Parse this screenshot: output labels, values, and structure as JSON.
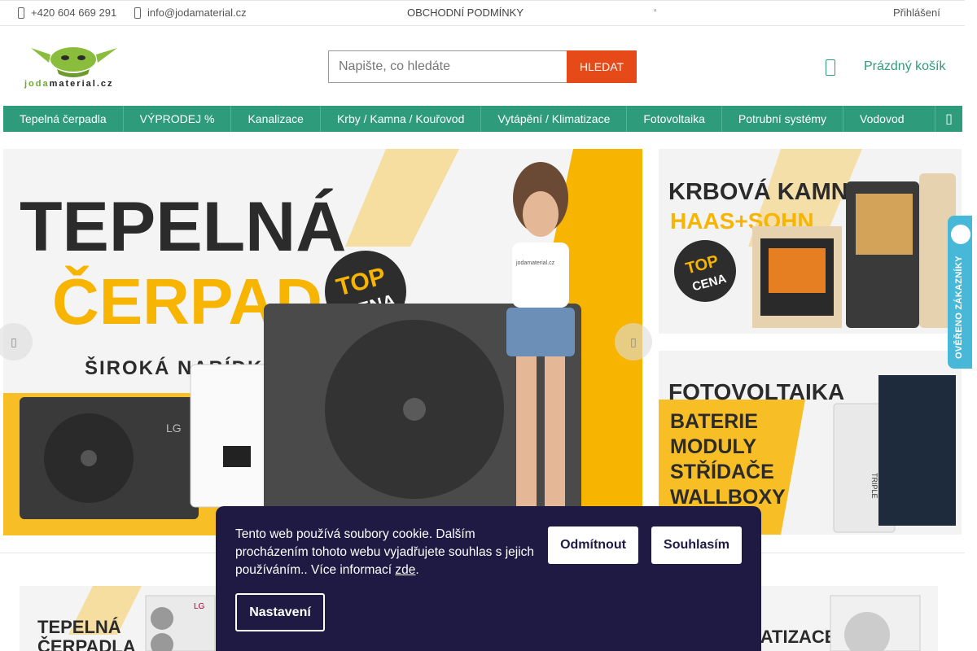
{
  "topbar": {
    "phone": "+420 604 669 291",
    "email": "info@jodamaterial.cz",
    "terms": "OBCHODNÍ PODMÍNKY",
    "login": "Přihlášení"
  },
  "logo": {
    "brand_highlight": "joda",
    "brand_rest": "material.cz"
  },
  "search": {
    "placeholder": "Napište, co hledáte",
    "button": "HLEDAT"
  },
  "cart": {
    "label": "Prázdný košík"
  },
  "nav": {
    "items": [
      "Tepelná čerpadla",
      "VÝPRODEJ %",
      "Kanalizace",
      "Krby / Kamna / Kouřovod",
      "Vytápění / Klimatizace",
      "Fotovoltaika",
      "Potrubní systémy",
      "Vodovod"
    ]
  },
  "hero": {
    "line1": "TEPELNÁ",
    "line2": "ČERPADLA",
    "subtitle": "ŠIROKÁ NABÍDKA",
    "badge_top": "TOP",
    "badge_bottom": "CENA",
    "shirt_text": "jodamaterial.cz",
    "product_logo": "LG"
  },
  "side1": {
    "line1": "KRBOVÁ KAMNA",
    "line2": "HAAS+SOHN",
    "badge_top": "TOP",
    "badge_bottom": "CENA"
  },
  "side2": {
    "line1": "FOTOVOLTAIKA",
    "items": [
      "BATERIE",
      "MODULY",
      "STŘÍDAČE",
      "WALLBOXY"
    ],
    "product_logo": "TRIPLE"
  },
  "rating": {
    "label": "OVĚŘENO ZÁKAZNÍKY"
  },
  "bottom": {
    "left_line1": "TEPELNÁ",
    "left_line2": "ČERPADLA",
    "left_brand": "LG",
    "right_text": "KLIMATIZACE"
  },
  "cookie": {
    "text": "Tento web používá soubory cookie. Dalším procházením tohoto webu vyjadřujete souhlas s jejich používáním.. Více informací",
    "link": "zde",
    "after": ".",
    "reject": "Odmítnout",
    "accept": "Souhlasím",
    "settings": "Nastavení"
  },
  "colors": {
    "accent": "#2e9c7b",
    "search_button": "#e64a19",
    "banner_yellow": "#f7b400",
    "cookie_bg": "#1f1a44",
    "rating": "#47b8d7"
  }
}
